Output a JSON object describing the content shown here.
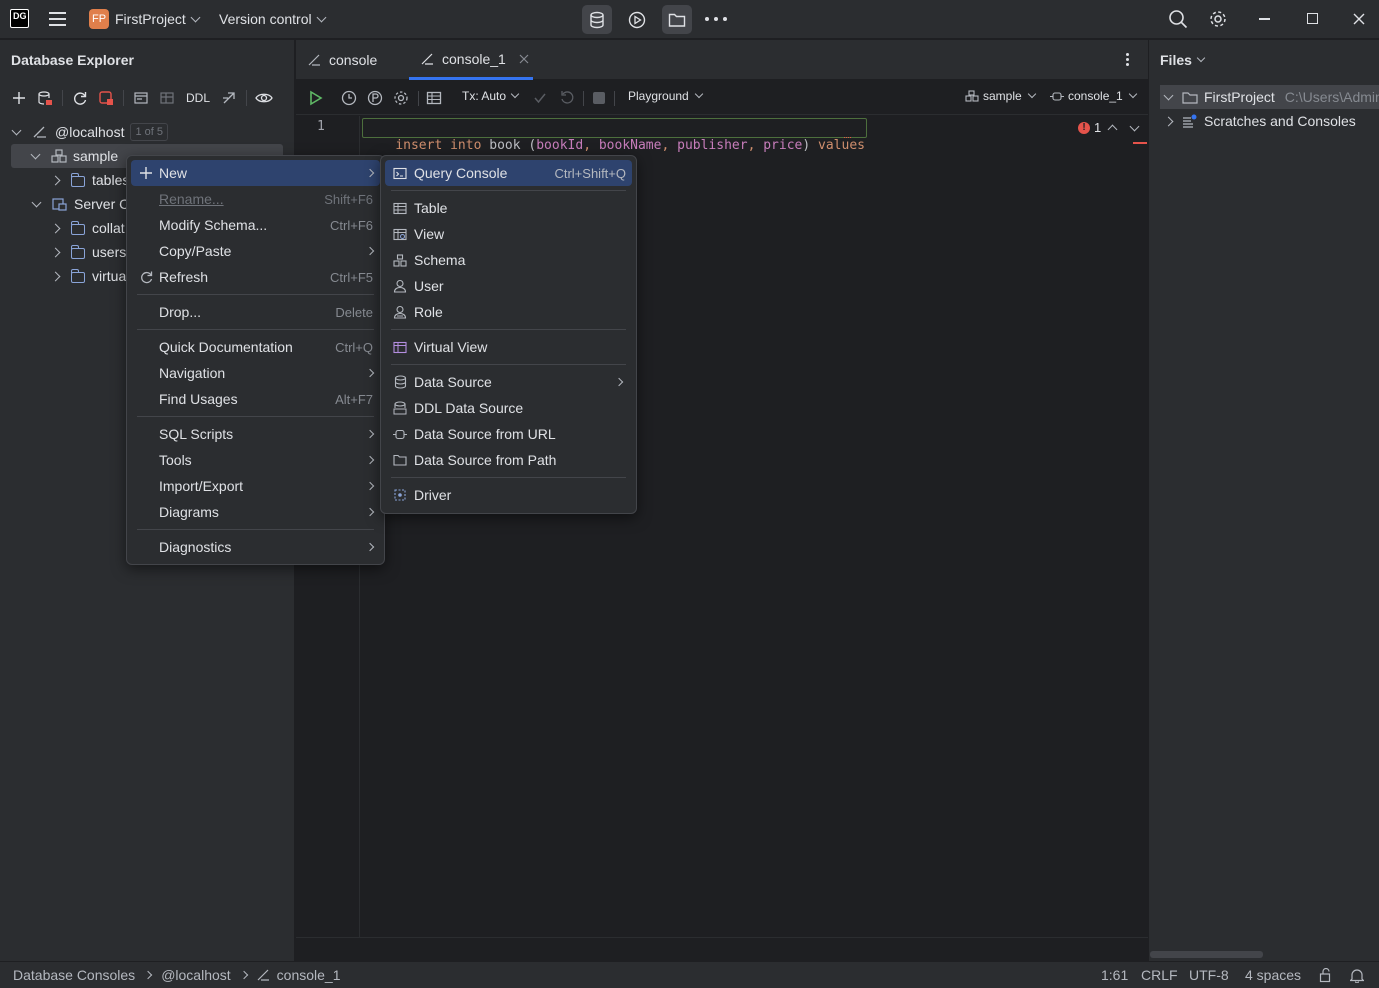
{
  "titlebar": {
    "app_logo": "DG",
    "project_badge": "FP",
    "project_name": "FirstProject",
    "vcs_label": "Version control"
  },
  "left_panel": {
    "title": "Database Explorer",
    "toolbar_ddl": "DDL",
    "tree": {
      "host": "@localhost",
      "host_badge": "1 of 5",
      "schema": "sample",
      "tables": "tables",
      "server": "Server C",
      "collations": "collat",
      "users": "users",
      "virtual": "virtua"
    }
  },
  "editor": {
    "tabs": [
      {
        "label": "console"
      },
      {
        "label": "console_1"
      }
    ],
    "toolbar": {
      "tx": "Tx: Auto",
      "playground": "Playground",
      "schema": "sample",
      "session": "console_1"
    },
    "line_number": "1",
    "code": {
      "kw1": "insert",
      "kw2": "into",
      "table": "book",
      "paren_open": "(",
      "col1": "bookId",
      "col2": "bookName",
      "col3": "publisher",
      "col4": "price",
      "paren_close": ")",
      "kw3": "values",
      "comma": ","
    },
    "problems_count": "1"
  },
  "context_menu": {
    "items": [
      {
        "label": "New",
        "shortcut": ""
      },
      {
        "label": "Rename...",
        "shortcut": "Shift+F6"
      },
      {
        "label": "Modify Schema...",
        "shortcut": "Ctrl+F6"
      },
      {
        "label": "Copy/Paste",
        "shortcut": ""
      },
      {
        "label": "Refresh",
        "shortcut": "Ctrl+F5"
      },
      {
        "label": "Drop...",
        "shortcut": "Delete"
      },
      {
        "label": "Quick Documentation",
        "shortcut": "Ctrl+Q"
      },
      {
        "label": "Navigation",
        "shortcut": ""
      },
      {
        "label": "Find Usages",
        "shortcut": "Alt+F7"
      },
      {
        "label": "SQL Scripts",
        "shortcut": ""
      },
      {
        "label": "Tools",
        "shortcut": ""
      },
      {
        "label": "Import/Export",
        "shortcut": ""
      },
      {
        "label": "Diagrams",
        "shortcut": ""
      },
      {
        "label": "Diagnostics",
        "shortcut": ""
      }
    ]
  },
  "submenu": {
    "items": [
      {
        "label": "Query Console",
        "shortcut": "Ctrl+Shift+Q"
      },
      {
        "label": "Table"
      },
      {
        "label": "View"
      },
      {
        "label": "Schema"
      },
      {
        "label": "User"
      },
      {
        "label": "Role"
      },
      {
        "label": "Virtual View"
      },
      {
        "label": "Data Source"
      },
      {
        "label": "DDL Data Source"
      },
      {
        "label": "Data Source from URL"
      },
      {
        "label": "Data Source from Path"
      },
      {
        "label": "Driver"
      }
    ]
  },
  "right_panel": {
    "title": "Files",
    "project": "FirstProject",
    "project_path": "C:\\Users\\Admin",
    "scratches": "Scratches and Consoles"
  },
  "statusbar": {
    "crumbs": [
      "Database Consoles",
      "@localhost",
      "console_1"
    ],
    "position": "1:61",
    "line_sep": "CRLF",
    "encoding": "UTF-8",
    "indent": "4 spaces"
  },
  "colors": {
    "accent": "#2e436e",
    "keyword": "#cf8e6d",
    "identifier": "#c77dbb",
    "error": "#e5534b"
  }
}
